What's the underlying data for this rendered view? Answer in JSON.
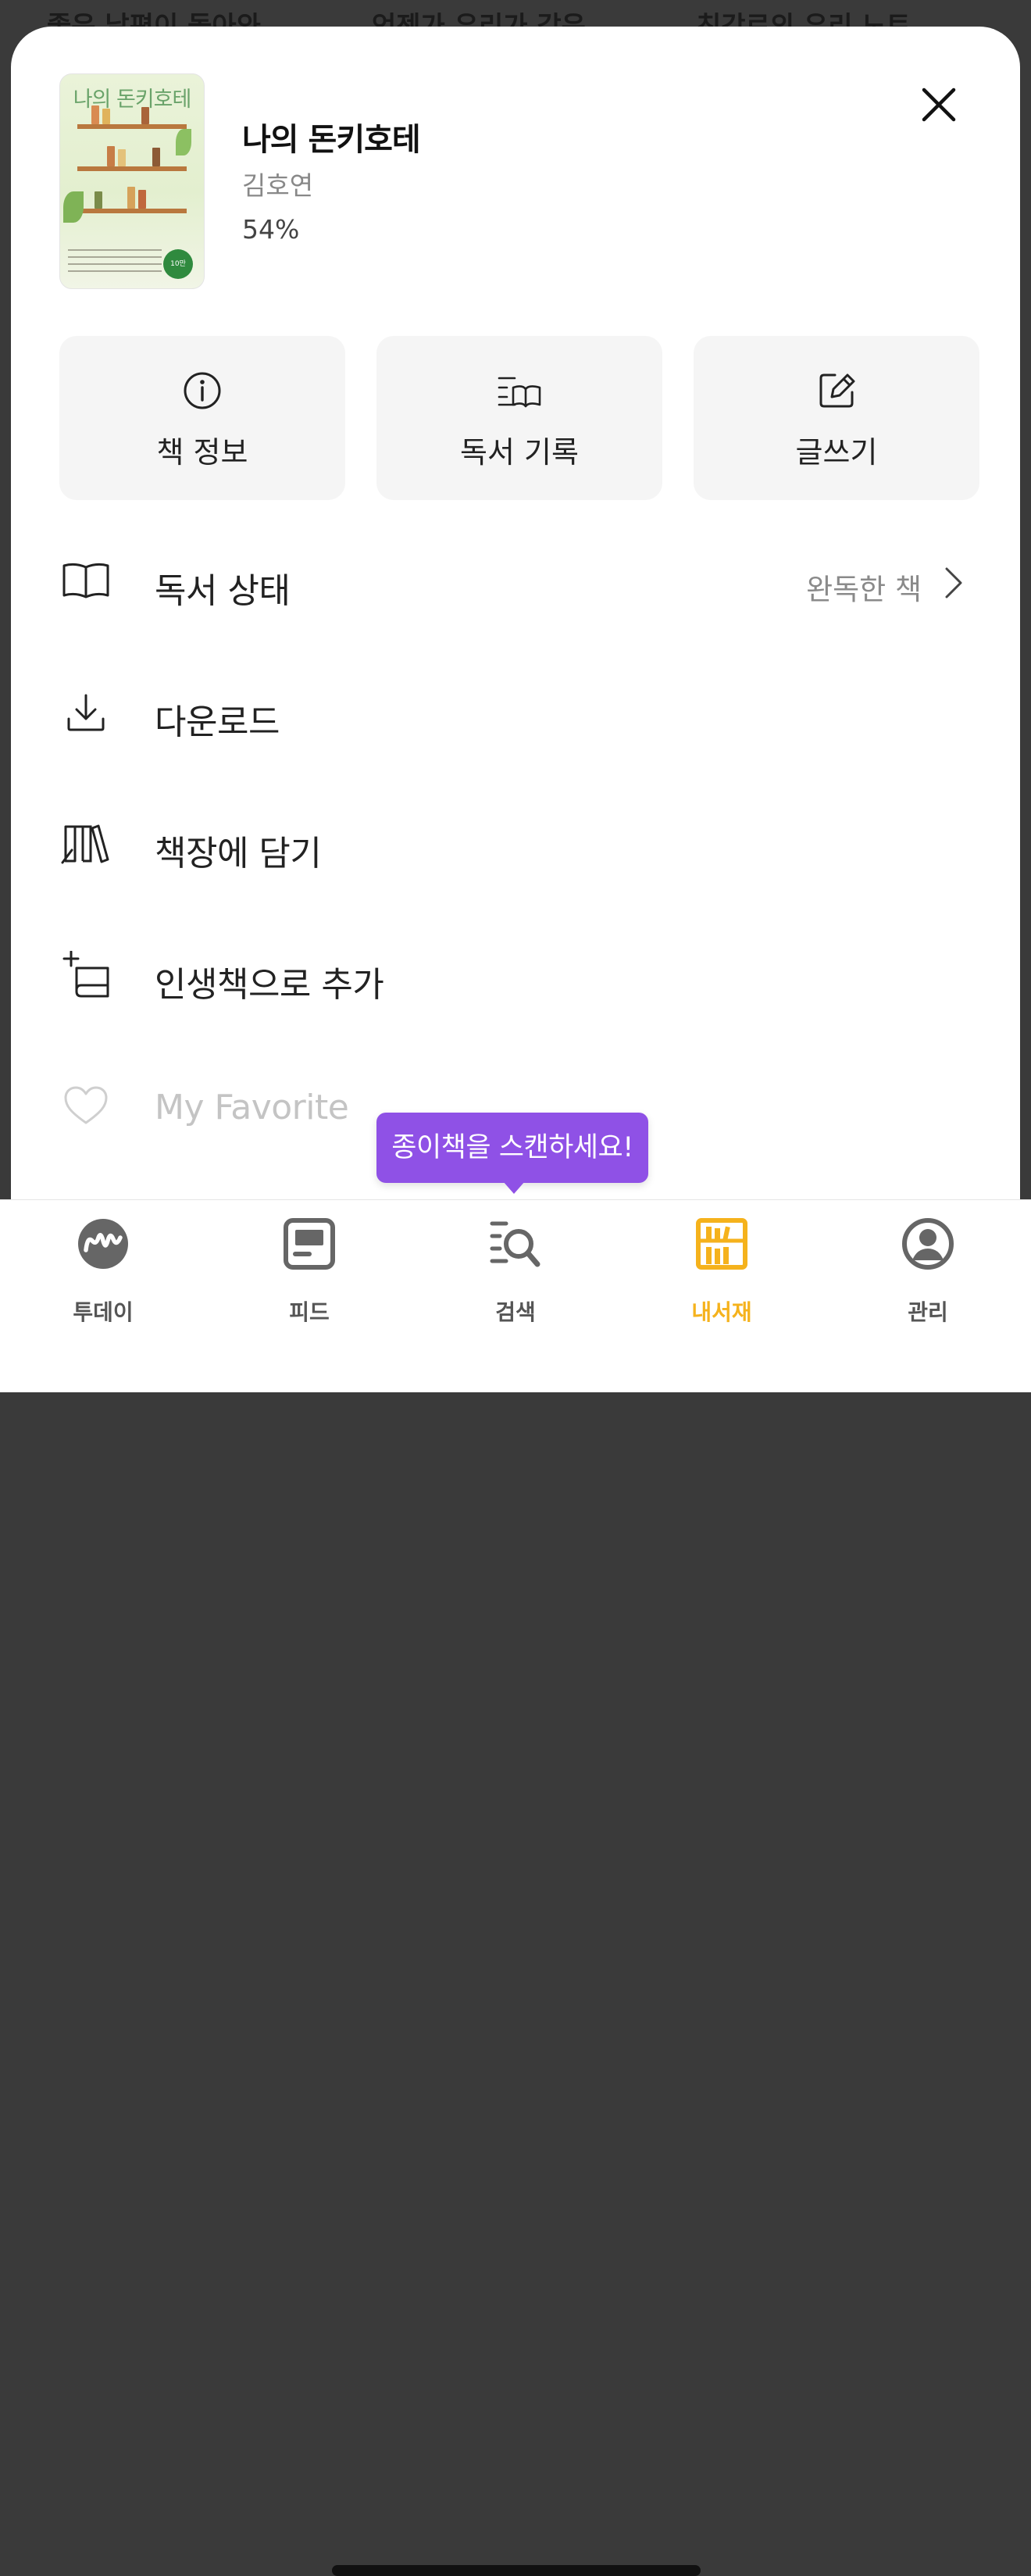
{
  "backdrop": {
    "titles": [
      "좋은 날편이 돌아와",
      "언젠가 우리가 같은",
      "친강로의 우리 노트"
    ]
  },
  "book": {
    "title": "나의 돈키호테",
    "author": "김호연",
    "progress": "54%",
    "cover_title": "나의 돈키호테",
    "cover_badge": "10만"
  },
  "actions": [
    {
      "label": "책 정보",
      "icon": "info-icon"
    },
    {
      "label": "독서 기록",
      "icon": "reading-log-icon"
    },
    {
      "label": "글쓰기",
      "icon": "edit-icon"
    }
  ],
  "menu": [
    {
      "label": "독서 상태",
      "icon": "open-book-icon",
      "value": "완독한 책"
    },
    {
      "label": "다운로드",
      "icon": "download-icon"
    },
    {
      "label": "책장에 담기",
      "icon": "bookshelf-icon"
    },
    {
      "label": "인생책으로 추가",
      "icon": "add-book-icon"
    },
    {
      "label": "My Favorite",
      "icon": "heart-icon"
    }
  ],
  "tooltip": "종이책을 스캔하세요!",
  "tabs": [
    {
      "label": "투데이",
      "icon": "today-icon",
      "active": false
    },
    {
      "label": "피드",
      "icon": "feed-icon",
      "active": false
    },
    {
      "label": "검색",
      "icon": "search-icon",
      "active": false
    },
    {
      "label": "내서재",
      "icon": "library-icon",
      "active": true
    },
    {
      "label": "관리",
      "icon": "profile-icon",
      "active": false
    }
  ],
  "colors": {
    "accent_active": "#f5b21c",
    "tooltip_bg": "#8f51e6",
    "card_bg": "#f5f5f5"
  }
}
